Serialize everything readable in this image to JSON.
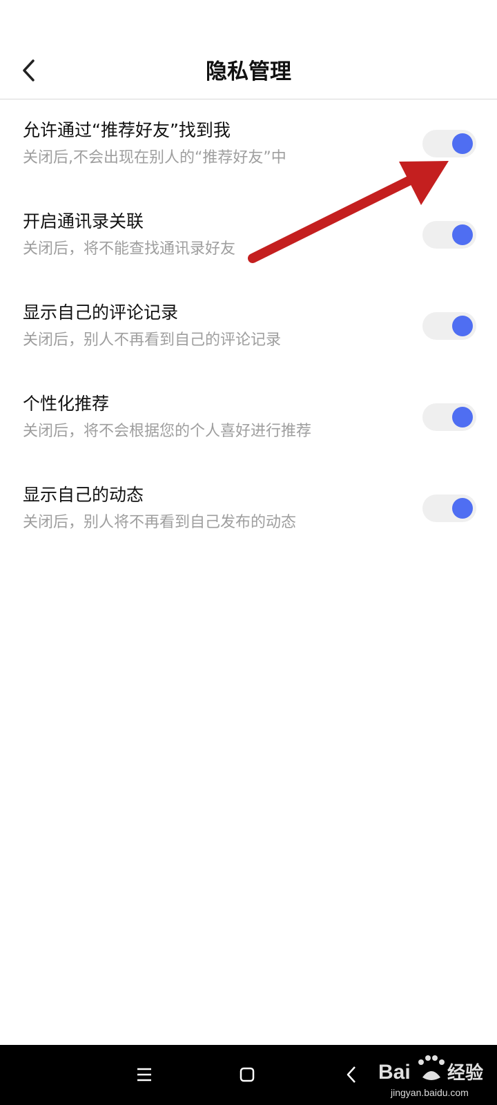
{
  "header": {
    "title": "隐私管理",
    "back_icon": "chevron-left-icon"
  },
  "settings": [
    {
      "title": "允许通过“推荐好友”找到我",
      "description": "关闭后,不会出现在别人的“推荐好友”中",
      "enabled": true
    },
    {
      "title": "开启通讯录关联",
      "description": "关闭后，将不能查找通讯录好友",
      "enabled": true
    },
    {
      "title": "显示自己的评论记录",
      "description": "关闭后，别人不再看到自己的评论记录",
      "enabled": true
    },
    {
      "title": "个性化推荐",
      "description": "关闭后，将不会根据您的个人喜好进行推荐",
      "enabled": true
    },
    {
      "title": "显示自己的动态",
      "description": "关闭后，别人将不再看到自己发布的动态",
      "enabled": true
    }
  ],
  "colors": {
    "toggle_on": "#4f6ef2",
    "toggle_track": "#efefef",
    "annotation_arrow": "#c41f1f"
  },
  "navbar": {
    "icons": [
      "menu-icon",
      "home-square-icon",
      "back-triangle-icon"
    ]
  },
  "watermark": {
    "logo_text": "Bai 经验",
    "url": "jingyan.baidu.com"
  }
}
